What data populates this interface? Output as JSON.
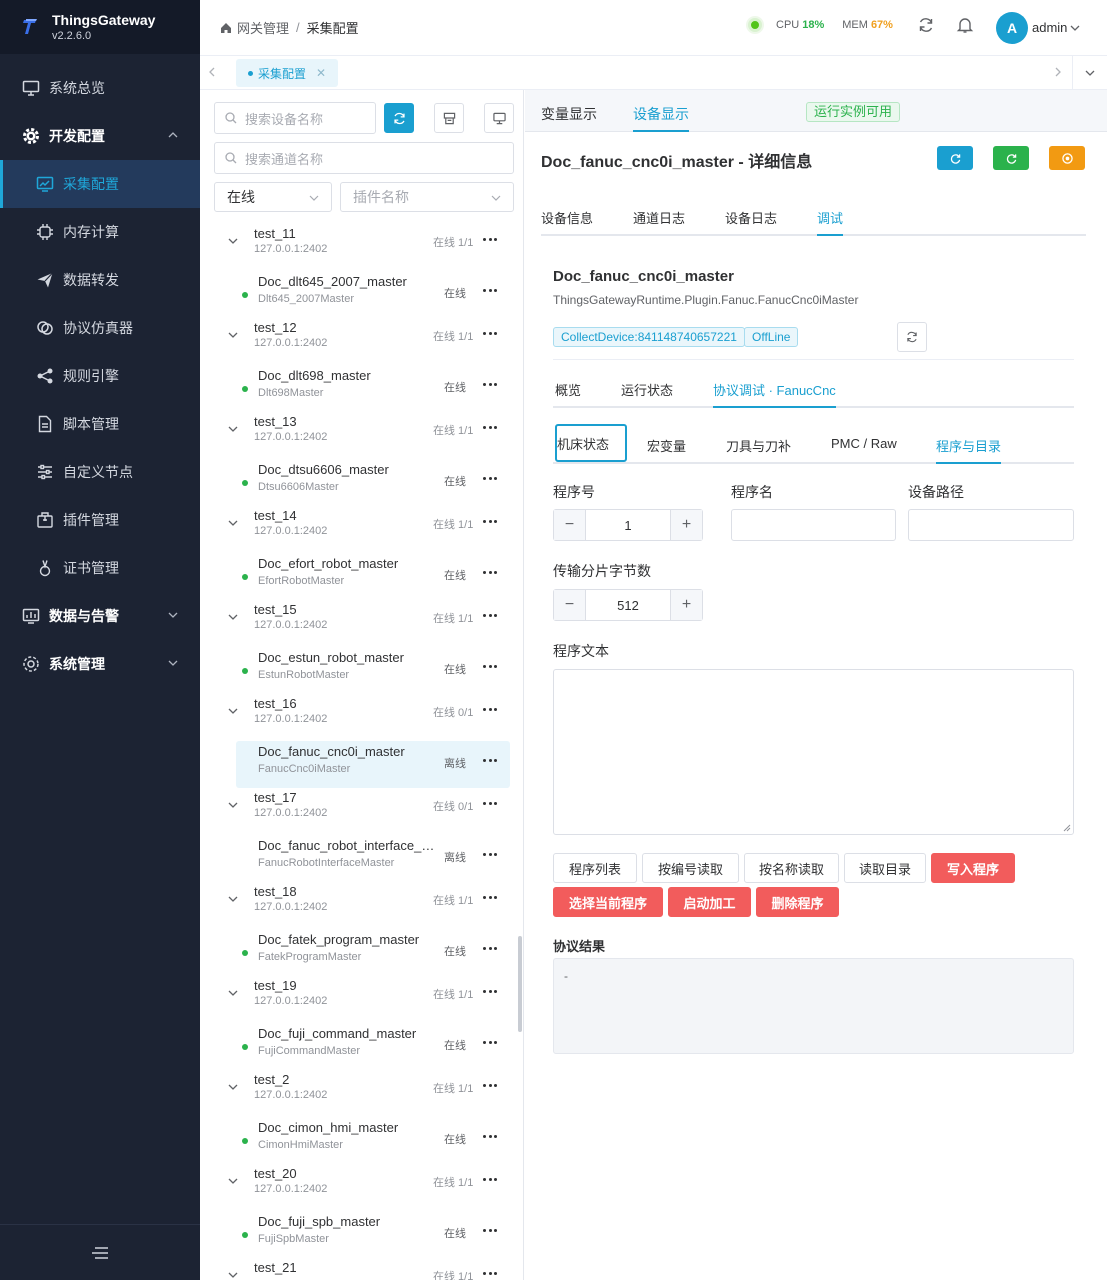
{
  "app": {
    "name": "ThingsGateway",
    "version": "v2.2.6.0"
  },
  "sidebar": {
    "items": [
      {
        "label": "系统总览",
        "level": "top",
        "icon": "monitor-icon"
      },
      {
        "label": "开发配置",
        "level": "top",
        "icon": "gear-icon",
        "expanded": true
      },
      {
        "label": "采集配置",
        "level": "sub",
        "icon": "chart-icon",
        "active": true
      },
      {
        "label": "内存计算",
        "level": "sub",
        "icon": "chip-icon"
      },
      {
        "label": "数据转发",
        "level": "sub",
        "icon": "send-icon"
      },
      {
        "label": "协议仿真器",
        "level": "sub",
        "icon": "link-icon"
      },
      {
        "label": "规则引擎",
        "level": "sub",
        "icon": "share-icon"
      },
      {
        "label": "脚本管理",
        "level": "sub",
        "icon": "file-icon"
      },
      {
        "label": "自定义节点",
        "level": "sub",
        "icon": "sliders-icon"
      },
      {
        "label": "插件管理",
        "level": "sub",
        "icon": "package-icon"
      },
      {
        "label": "证书管理",
        "level": "sub",
        "icon": "certificate-icon"
      },
      {
        "label": "数据与告警",
        "level": "top",
        "icon": "dashboard-icon"
      },
      {
        "label": "系统管理",
        "level": "top",
        "icon": "settings-icon"
      }
    ]
  },
  "header": {
    "breadcrumb": [
      "网关管理",
      "采集配置"
    ],
    "cpu_label": "CPU",
    "cpu_value": "18%",
    "mem_label": "MEM",
    "mem_value": "67%",
    "avatar_letter": "A",
    "user": "admin"
  },
  "tabbar": {
    "tab": "采集配置"
  },
  "left": {
    "search_device_placeholder": "搜索设备名称",
    "search_channel_placeholder": "搜索通道名称",
    "status_select": "在线",
    "plugin_select_placeholder": "插件名称",
    "groups": [
      {
        "name": "test_11",
        "ip": "127.0.0.1:2402",
        "status": "在线 1/1",
        "device": {
          "name": "Doc_dlt645_2007_master",
          "plugin": "Dlt645_2007Master",
          "status": "在线",
          "online": true
        }
      },
      {
        "name": "test_12",
        "ip": "127.0.0.1:2402",
        "status": "在线 1/1",
        "device": {
          "name": "Doc_dlt698_master",
          "plugin": "Dlt698Master",
          "status": "在线",
          "online": true
        }
      },
      {
        "name": "test_13",
        "ip": "127.0.0.1:2402",
        "status": "在线 1/1",
        "device": {
          "name": "Doc_dtsu6606_master",
          "plugin": "Dtsu6606Master",
          "status": "在线",
          "online": true
        }
      },
      {
        "name": "test_14",
        "ip": "127.0.0.1:2402",
        "status": "在线 1/1",
        "device": {
          "name": "Doc_efort_robot_master",
          "plugin": "EfortRobotMaster",
          "status": "在线",
          "online": true
        }
      },
      {
        "name": "test_15",
        "ip": "127.0.0.1:2402",
        "status": "在线 1/1",
        "device": {
          "name": "Doc_estun_robot_master",
          "plugin": "EstunRobotMaster",
          "status": "在线",
          "online": true
        }
      },
      {
        "name": "test_16",
        "ip": "127.0.0.1:2402",
        "status": "在线 0/1",
        "device": {
          "name": "Doc_fanuc_cnc0i_master",
          "plugin": "FanucCnc0iMaster",
          "status": "离线",
          "online": false,
          "selected": true
        }
      },
      {
        "name": "test_17",
        "ip": "127.0.0.1:2402",
        "status": "在线 0/1",
        "device": {
          "name": "Doc_fanuc_robot_interface_m...",
          "plugin": "FanucRobotInterfaceMaster",
          "status": "离线",
          "online": false
        }
      },
      {
        "name": "test_18",
        "ip": "127.0.0.1:2402",
        "status": "在线 1/1",
        "device": {
          "name": "Doc_fatek_program_master",
          "plugin": "FatekProgramMaster",
          "status": "在线",
          "online": true
        }
      },
      {
        "name": "test_19",
        "ip": "127.0.0.1:2402",
        "status": "在线 1/1",
        "device": {
          "name": "Doc_fuji_command_master",
          "plugin": "FujiCommandMaster",
          "status": "在线",
          "online": true
        }
      },
      {
        "name": "test_2",
        "ip": "127.0.0.1:2402",
        "status": "在线 1/1",
        "device": {
          "name": "Doc_cimon_hmi_master",
          "plugin": "CimonHmiMaster",
          "status": "在线",
          "online": true
        }
      },
      {
        "name": "test_20",
        "ip": "127.0.0.1:2402",
        "status": "在线 1/1",
        "device": {
          "name": "Doc_fuji_spb_master",
          "plugin": "FujiSpbMaster",
          "status": "在线",
          "online": true
        }
      },
      {
        "name": "test_21",
        "ip": "",
        "status": "在线 1/1",
        "device": null
      }
    ]
  },
  "right": {
    "top_tabs": [
      "变量显示",
      "设备显示"
    ],
    "title": "Doc_fanuc_cnc0i_master - 详细信息",
    "detail_tabs": [
      "设备信息",
      "通道日志",
      "设备日志",
      "调试"
    ],
    "device_name": "Doc_fanuc_cnc0i_master",
    "plugin_path": "ThingsGatewayRuntime.Plugin.Fanuc.FanucCnc0iMaster",
    "tags": [
      "CollectDevice:841148740657221",
      "OffLine",
      "运行实例可用"
    ],
    "debug_tabs": [
      "概览",
      "运行状态",
      "协议调试 · FanucCnc"
    ],
    "proto_tabs": [
      "机床状态",
      "宏变量",
      "刀具与刀补",
      "PMC / Raw",
      "程序与目录"
    ],
    "form": {
      "program_no_label": "程序号",
      "program_no": "1",
      "program_name_label": "程序名",
      "program_name": "",
      "device_path_label": "设备路径",
      "device_path": "",
      "chunk_label": "传输分片字节数",
      "chunk": "512",
      "text_label": "程序文本"
    },
    "buttons": {
      "list": "程序列表",
      "read_by_no": "按编号读取",
      "read_by_name": "按名称读取",
      "read_dir": "读取目录",
      "write": "写入程序",
      "select_current": "选择当前程序",
      "start": "启动加工",
      "delete": "删除程序"
    },
    "result_label": "协议结果",
    "result_text": "-"
  },
  "colors": {
    "accent": "#1a9fd0",
    "sidebar": "#1c2333",
    "danger": "#f25c5c",
    "online": "#2bb24c"
  }
}
